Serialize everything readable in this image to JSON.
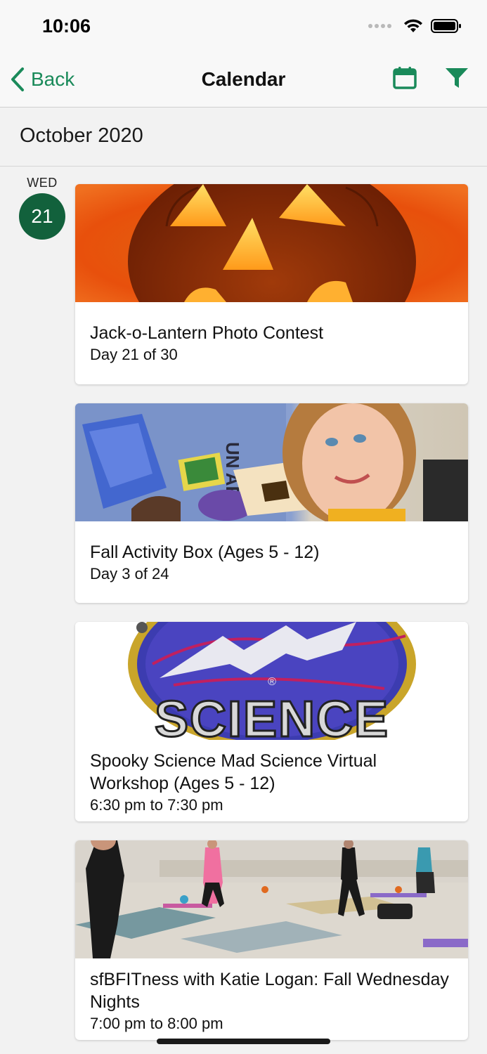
{
  "status_bar": {
    "time": "10:06"
  },
  "nav": {
    "back_label": "Back",
    "title": "Calendar"
  },
  "month": "October 2020",
  "day": {
    "weekday": "WED",
    "date": "21"
  },
  "colors": {
    "accent": "#1a8a5a",
    "day_circle": "#12613c"
  },
  "events": [
    {
      "title": "Jack-o-Lantern Photo Contest",
      "subtitle": "Day 21 of 30",
      "image": "jack-o-lantern-photo"
    },
    {
      "title": "Fall Activity Box (Ages 5 - 12)",
      "subtitle": "Day 3 of 24",
      "image": "child-with-activity-box-photo"
    },
    {
      "title": "Spooky Science Mad Science Virtual Workshop (Ages 5 - 12)",
      "subtitle": "6:30 pm to 7:30 pm",
      "image": "mad-science-logo",
      "logo_text": "SCIENCE"
    },
    {
      "title": "sfBFITness with Katie Logan: Fall Wednesday Nights",
      "subtitle": "7:00 pm to 8:00 pm",
      "image": "fitness-class-gym-photo"
    }
  ]
}
